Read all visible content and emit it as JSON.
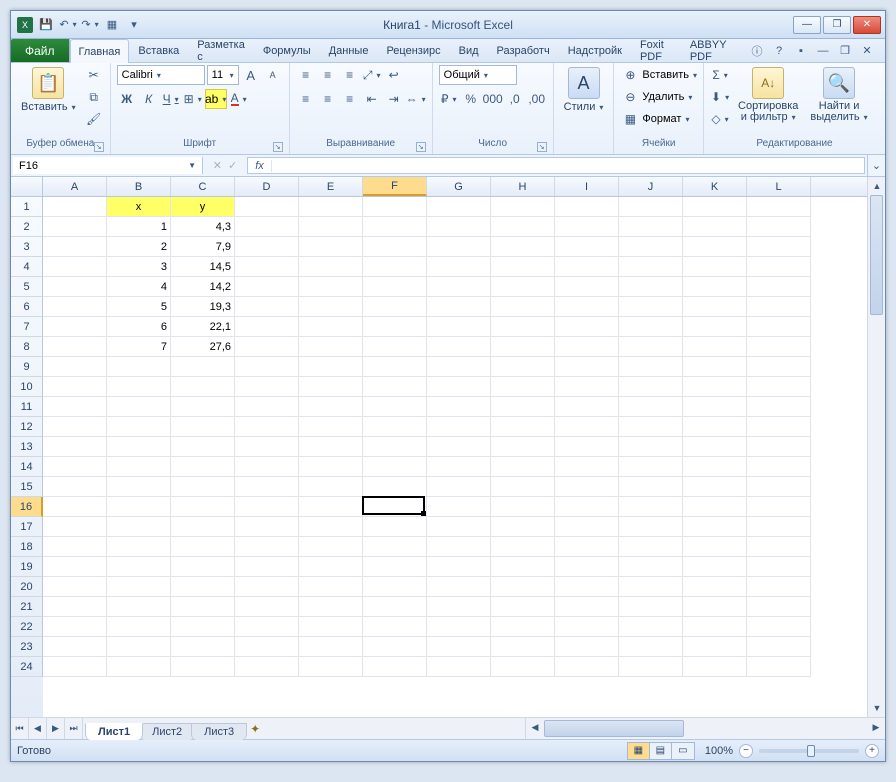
{
  "title": {
    "document": "Книга1",
    "app": "Microsoft Excel"
  },
  "qat": {
    "save": "💾",
    "undo": "↶",
    "redo": "↷",
    "more": "▦"
  },
  "window_controls": {
    "min": "―",
    "max": "❐",
    "close": "✕"
  },
  "tabs": {
    "file": "Файл",
    "items": [
      "Главная",
      "Вставка",
      "Разметка с",
      "Формулы",
      "Данные",
      "Рецензирс",
      "Вид",
      "Разработч",
      "Надстройк",
      "Foxit PDF",
      "ABBYY PDF"
    ],
    "active_index": 0
  },
  "ribbon_help": {
    "help": "?",
    "dd": "▾"
  },
  "ribbon": {
    "clipboard": {
      "paste": "Вставить",
      "label": "Буфер обмена",
      "cut": "✂",
      "copy": "⧉",
      "brush": "🖌"
    },
    "font": {
      "name": "Calibri",
      "size": "11",
      "bold": "Ж",
      "italic": "К",
      "underline": "Ч",
      "border": "⊞",
      "fill": "A",
      "color": "A",
      "grow": "A",
      "shrink": "A",
      "label": "Шрифт"
    },
    "align": {
      "label": "Выравнивание",
      "wrap": "↩",
      "merge": "⇔"
    },
    "number": {
      "format": "Общий",
      "currency": "₽",
      "percent": "%",
      "comma": ",0",
      "inc": "←,0",
      "dec": ",0→",
      "label": "Число"
    },
    "styles": {
      "btn": "Стили",
      "label": ""
    },
    "cells": {
      "insert": "Вставить",
      "delete": "Удалить",
      "format": "Формат",
      "label": "Ячейки"
    },
    "editing": {
      "sum": "Σ",
      "fill": "⬇",
      "clear": "◇",
      "sort": "Сортировка\nи фильтр",
      "find": "Найти и\nвыделить",
      "label": "Редактирование"
    }
  },
  "namebox": {
    "ref": "F16",
    "fx": "fx",
    "formula": ""
  },
  "grid": {
    "columns": [
      "A",
      "B",
      "C",
      "D",
      "E",
      "F",
      "G",
      "H",
      "I",
      "J",
      "K",
      "L"
    ],
    "rows": 24,
    "selected_col_index": 5,
    "selected_row": 16,
    "headers": {
      "b1": "x",
      "c1": "y"
    },
    "data": [
      {
        "x": "1",
        "y": "4,3"
      },
      {
        "x": "2",
        "y": "7,9"
      },
      {
        "x": "3",
        "y": "14,5"
      },
      {
        "x": "4",
        "y": "14,2"
      },
      {
        "x": "5",
        "y": "19,3"
      },
      {
        "x": "6",
        "y": "22,1"
      },
      {
        "x": "7",
        "y": "27,6"
      }
    ]
  },
  "sheets": {
    "items": [
      "Лист1",
      "Лист2",
      "Лист3"
    ],
    "active_index": 0
  },
  "status": {
    "ready": "Готово",
    "zoom": "100%"
  }
}
